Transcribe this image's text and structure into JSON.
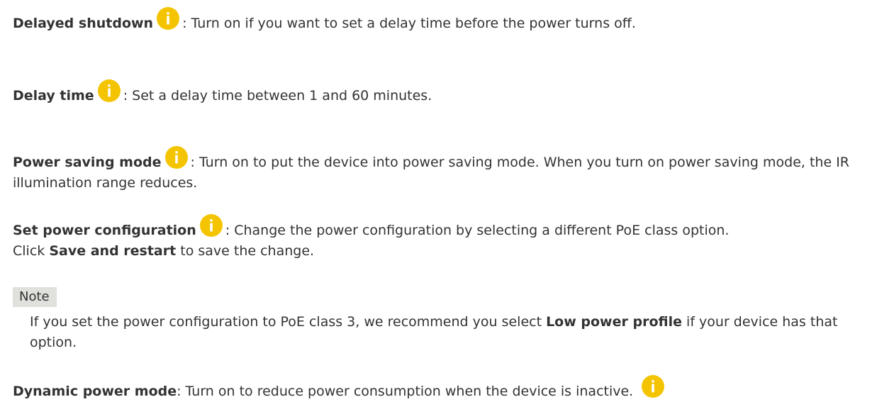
{
  "icons": {
    "info": "info-icon",
    "color": "#f5c400"
  },
  "items": [
    {
      "term": "Delayed shutdown",
      "description": ": Turn on if you want to set a delay time before the power turns off."
    },
    {
      "term": "Delay time",
      "description": ": Set a delay time between 1 and 60 minutes."
    },
    {
      "term": "Power saving mode",
      "description": ": Turn on to put the device into power saving mode. When you turn on power saving mode, the IR illumination range reduces."
    },
    {
      "term": "Set power configuration",
      "description": ": Change the power configuration by selecting a different PoE class option.",
      "line2_prefix": "Click ",
      "line2_bold": "Save and restart",
      "line2_suffix": " to save the change."
    }
  ],
  "note": {
    "label": "Note",
    "text_prefix": "If you set the power configuration to PoE class 3, we recommend you select ",
    "text_bold": "Low power profile",
    "text_suffix": " if your device has that option."
  },
  "dynamic": {
    "term": "Dynamic power mode",
    "description": ": Turn on to reduce power consumption when the device is inactive."
  }
}
